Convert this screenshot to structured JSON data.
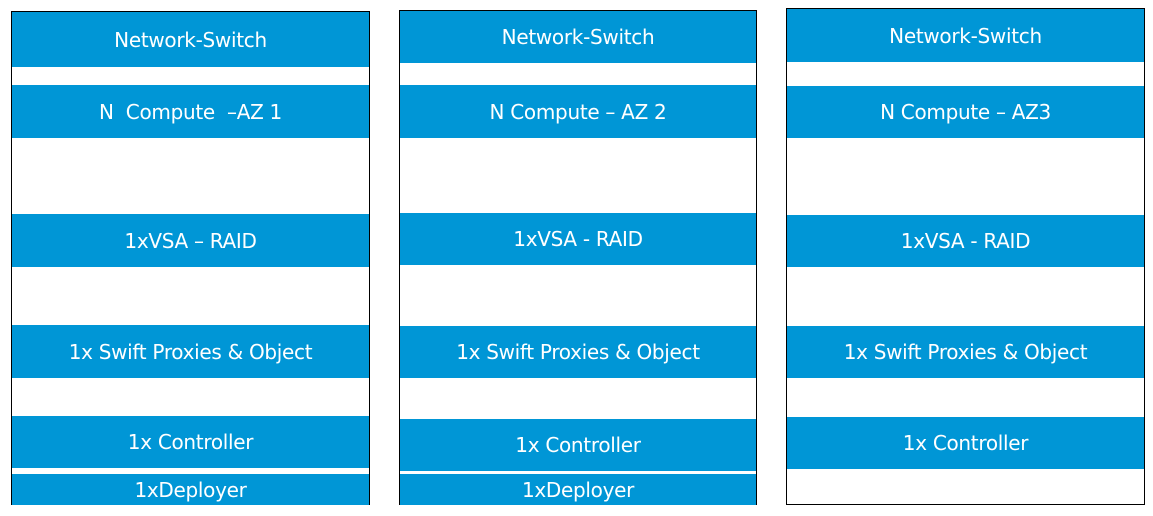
{
  "colors": {
    "block_fill": "#0096d6",
    "block_text": "#ffffff",
    "border": "#000000"
  },
  "columns": [
    {
      "switch": "Network-Switch",
      "compute": "N  Compute  –AZ 1",
      "vsa": "1xVSA – RAID",
      "swift": "1x Swift Proxies & Object",
      "controller": "1x Controller",
      "deployer": "1xDeployer"
    },
    {
      "switch": "Network-Switch",
      "compute": "N Compute – AZ 2",
      "vsa": "1xVSA - RAID",
      "swift": "1x Swift Proxies & Object",
      "controller": "1x Controller",
      "deployer": "1xDeployer"
    },
    {
      "switch": "Network-Switch",
      "compute": "N Compute – AZ3",
      "vsa": "1xVSA - RAID",
      "swift": "1x Swift Proxies & Object",
      "controller": "1x Controller"
    }
  ]
}
